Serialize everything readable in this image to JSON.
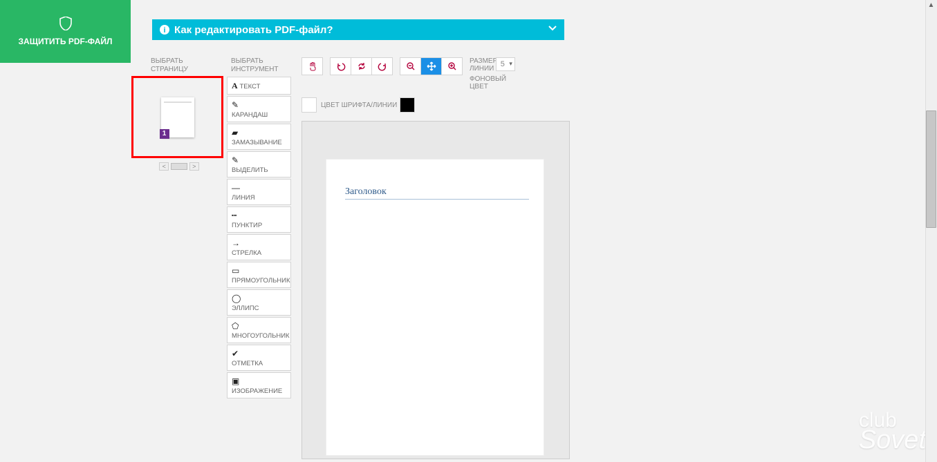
{
  "protect_button": {
    "label": "ЗАЩИТИТЬ PDF-ФАЙЛ"
  },
  "help_banner": {
    "text": "Как редактировать PDF-файл?"
  },
  "page_select": {
    "label_line1": "ВЫБРАТЬ",
    "label_line2": "СТРАНИЦУ",
    "current": "1"
  },
  "tools": {
    "label_line1": "ВЫБРАТЬ",
    "label_line2": "ИНСТРУМЕНТ",
    "items": [
      {
        "label": "ТЕКСТ",
        "icon": "A"
      },
      {
        "label": "КАРАНДАШ",
        "icon": "✎"
      },
      {
        "label": "ЗАМАЗЫВАНИЕ",
        "icon": "▰"
      },
      {
        "label": "ВЫДЕЛИТЬ",
        "icon": "✎"
      },
      {
        "label": "ЛИНИЯ",
        "icon": "—"
      },
      {
        "label": "ПУНКТИР",
        "icon": "┅"
      },
      {
        "label": "СТРЕЛКА",
        "icon": "→"
      },
      {
        "label": "ПРЯМОУГОЛЬНИК",
        "icon": "▭"
      },
      {
        "label": "ЭЛЛИПС",
        "icon": "◯"
      },
      {
        "label": "МНОГОУГОЛЬНИК",
        "icon": "⬠"
      },
      {
        "label": "ОТМЕТКА",
        "icon": "✔"
      },
      {
        "label": "ИЗОБРАЖЕНИЕ",
        "icon": "▣"
      }
    ]
  },
  "toolbar": {
    "size_label_line1": "РАЗМЕР",
    "size_label_line2": "ЛИНИИ",
    "size_value": "5",
    "bgcolor_label_line1": "ФОНОВЫЙ",
    "bgcolor_label_line2": "ЦВЕТ",
    "fontcolor_label": "ЦВЕТ ШРИФТА/ЛИНИИ"
  },
  "document": {
    "title": "Заголовок"
  },
  "watermark": {
    "line1": "club",
    "line2": "Sovet"
  }
}
